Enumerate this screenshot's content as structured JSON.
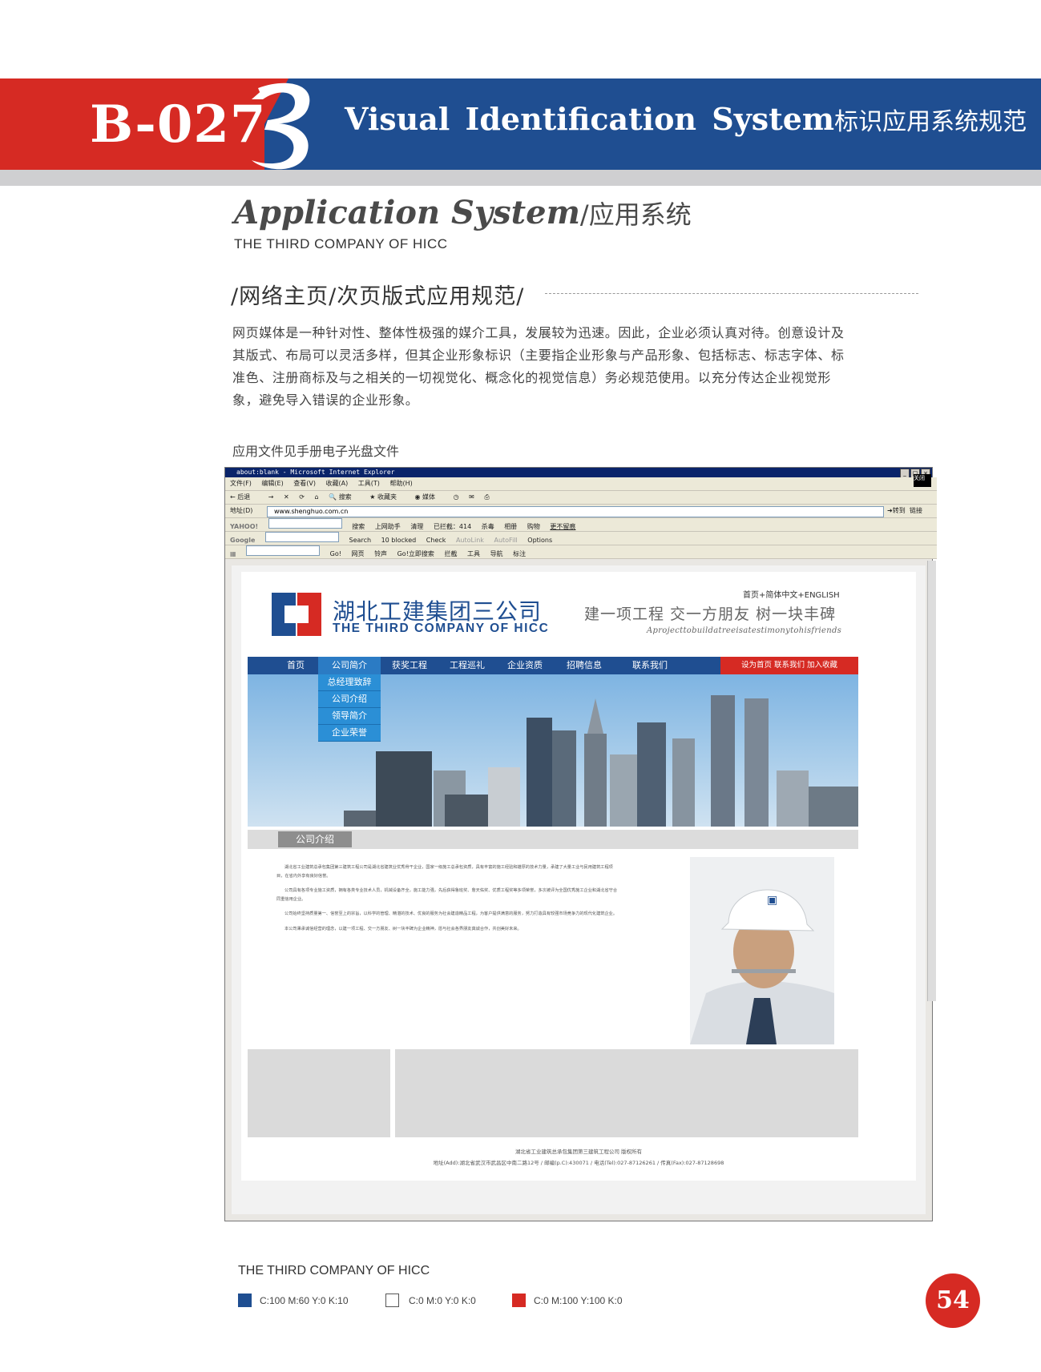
{
  "header": {
    "code": "B-027",
    "title": "Visual Identification System",
    "title_cn": "标识应用系统规范"
  },
  "page_title": {
    "en": "Application System",
    "cn": "/应用系统",
    "subtitle": "THE THIRD COMPANY OF HICC"
  },
  "section": {
    "title": "/网络主页/次页版式应用规范/",
    "body": "网页媒体是一种针对性、整体性极强的媒介工具，发展较为迅速。因此，企业必须认真对待。创意设计及其版式、布局可以灵活多样，但其企业形象标识（主要指企业形象与产品形象、包括标志、标志字体、标准色、注册商标及与之相关的一切视觉化、概念化的视觉信息）务必规范使用。以充分传达企业视觉形象，避免导入错误的企业形象。",
    "note": "应用文件见手册电子光盘文件"
  },
  "browser": {
    "title": "about:blank - Microsoft Internet Explorer",
    "menu": [
      "文件(F)",
      "编辑(E)",
      "查看(V)",
      "收藏(A)",
      "工具(T)",
      "帮助(H)"
    ],
    "toolbar": [
      "后退",
      "搜索",
      "收藏夹",
      "媒体"
    ],
    "address_label": "地址(D)",
    "address": "www.shenghuo.com.cn",
    "go": "转到",
    "links": "链接",
    "yahoo_row": [
      "YAHOO!",
      "搜索",
      "上网助手",
      "清理",
      "已拦截：414",
      "杀毒",
      "相册",
      "购物",
      "更不留痕"
    ],
    "google_row": [
      "Google",
      "Search",
      "10 blocked",
      "Check",
      "AutoLink",
      "AutoFill",
      "Options"
    ],
    "third_row": [
      "Go!",
      "网页",
      "铃声",
      "Go!立即搜索",
      "拦截",
      "工具",
      "导航",
      "标注"
    ],
    "logo_box": "关闭"
  },
  "site": {
    "name_cn": "湖北工建集团三公司",
    "name_en": "THE THIRD COMPANY OF HICC",
    "top_links": "首页+简体中文+ENGLISH",
    "slogan": "建一项工程  交一方朋友  树一块丰碑",
    "slogan_en": "Aprojecttobuildatreeisatestimonytohisfriends",
    "nav": [
      "首页",
      "公司简介",
      "获奖工程",
      "工程巡礼",
      "企业资质",
      "招聘信息",
      "联系我们"
    ],
    "nav_right": "设为首页  联系我们  加入收藏",
    "submenu": [
      "总经理致辞",
      "公司介绍",
      "领导简介",
      "企业荣誉"
    ],
    "section_tab": "公司介绍",
    "article": [
      "湖北省工业建筑总承包集团第三建筑工程公司是湖北省建筑业优秀骨干企业，国家一级施工总承包资质，具有丰富的施工经验和雄厚的技术力量，承建了大量工业与民用建筑工程项目，在省内外享有良好信誉。",
      "公司具有各项专业施工资质，拥有各类专业技术人员，机械设备齐全，施工能力强，先后获得鲁班奖、詹天佑奖、优质工程奖等多项荣誉，多次被评为全国优秀施工企业和湖北省守合同重信用企业。",
      "公司始终坚持质量第一、信誉至上的宗旨，以科学的管理、精湛的技术、优良的服务为社会建造精品工程，为客户提供满意的服务，努力打造具有较强市场竞争力的现代化建筑企业。",
      "本公司秉承诚信经营的理念，以建一项工程、交一方朋友、树一块丰碑为企业精神，愿与社会各界朋友真诚合作，共创美好未来。"
    ],
    "footer_copyright": "湖北省工业建筑总承包集团第三建筑工程公司 版权所有",
    "footer_address": "地址(Add):湖北省武汉市武昌区中南二路12号 / 邮编(p.C):430071 / 电话(Tel):027-87126261 / 传真(Fax):027-87128698"
  },
  "bottom": {
    "company": "THE THIRD COMPANY OF HICC",
    "swatches": [
      {
        "label": "C:100 M:60 Y:0 K:10",
        "color": "#1f4e91"
      },
      {
        "label": "C:0 M:0 Y:0 K:0",
        "color": "#ffffff"
      },
      {
        "label": "C:0 M:100 Y:100 K:0",
        "color": "#d62a23"
      }
    ],
    "page_number": "54"
  },
  "colors": {
    "brand_blue": "#1f4e91",
    "brand_red": "#d62a23"
  }
}
